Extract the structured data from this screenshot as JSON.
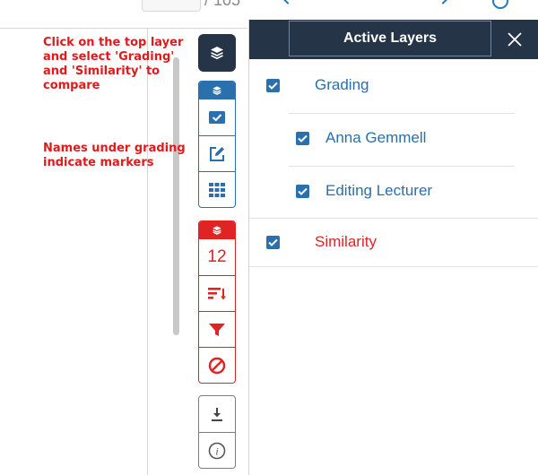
{
  "top": {
    "page_fragment": "/ 105"
  },
  "notes": {
    "line1": "Click on the top layer",
    "line2": "and select 'Grading'",
    "line3": "and 'Similarity' to",
    "line4": "compare",
    "line5": "Names under grading",
    "line6": "indicate markers"
  },
  "toolbar": {
    "similarity_count": "12",
    "icons": [
      "layers-icon",
      "checkbox-icon",
      "edit-icon",
      "grid-icon",
      "sort-icon",
      "filter-icon",
      "ban-icon",
      "download-icon",
      "info-icon"
    ]
  },
  "panel": {
    "title": "Active Layers",
    "close_icon": "close-icon",
    "layers": [
      {
        "label": "Grading",
        "checked": true,
        "indent": 0,
        "color": "#2a6fae"
      },
      {
        "label": "Anna Gemmell",
        "checked": true,
        "indent": 1,
        "color": "#2a6fae"
      },
      {
        "label": "Editing Lecturer",
        "checked": true,
        "indent": 1,
        "color": "#2a6fae"
      },
      {
        "label": "Similarity",
        "checked": true,
        "indent": 0,
        "color": "#e02424"
      }
    ]
  },
  "colors": {
    "navy": "#253447",
    "blue": "#2a6fae",
    "red": "#e02424",
    "note_red": "#e01b1b"
  }
}
